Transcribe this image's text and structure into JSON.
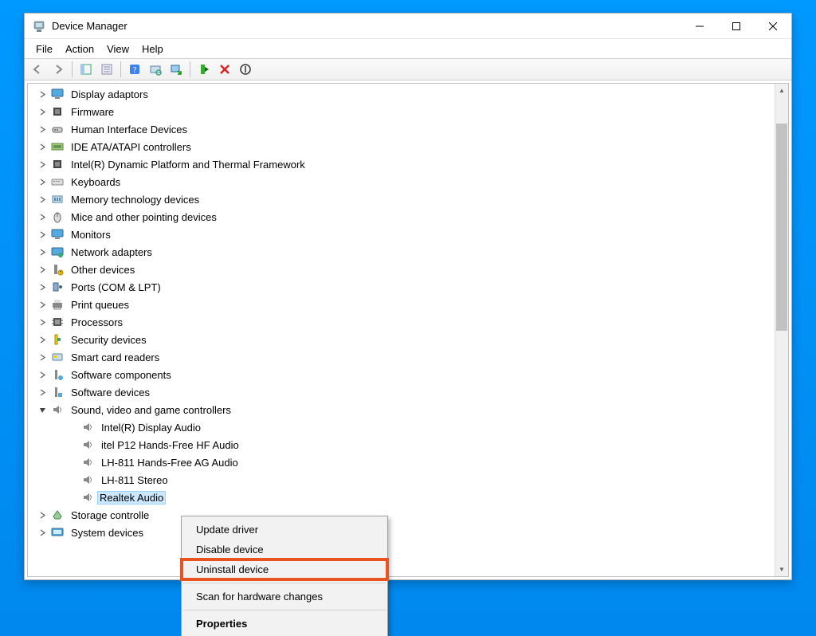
{
  "window": {
    "title": "Device Manager"
  },
  "menu": {
    "file": "File",
    "action": "Action",
    "view": "View",
    "help": "Help"
  },
  "tree": {
    "items": [
      {
        "label": "Display adaptors",
        "icon": "monitor"
      },
      {
        "label": "Firmware",
        "icon": "chip"
      },
      {
        "label": "Human Interface Devices",
        "icon": "hid"
      },
      {
        "label": "IDE ATA/ATAPI controllers",
        "icon": "ide"
      },
      {
        "label": "Intel(R) Dynamic Platform and Thermal Framework",
        "icon": "chip"
      },
      {
        "label": "Keyboards",
        "icon": "keyboard"
      },
      {
        "label": "Memory technology devices",
        "icon": "memory"
      },
      {
        "label": "Mice and other pointing devices",
        "icon": "mouse"
      },
      {
        "label": "Monitors",
        "icon": "monitor"
      },
      {
        "label": "Network adapters",
        "icon": "network"
      },
      {
        "label": "Other devices",
        "icon": "other"
      },
      {
        "label": "Ports (COM & LPT)",
        "icon": "port"
      },
      {
        "label": "Print queues",
        "icon": "printer"
      },
      {
        "label": "Processors",
        "icon": "cpu"
      },
      {
        "label": "Security devices",
        "icon": "security"
      },
      {
        "label": "Smart card readers",
        "icon": "smartcard"
      },
      {
        "label": "Software components",
        "icon": "softcomp"
      },
      {
        "label": "Software devices",
        "icon": "softdev"
      },
      {
        "label": "Sound, video and game controllers",
        "icon": "speaker",
        "expanded": true
      },
      {
        "label": "Storage controllers",
        "icon": "storage",
        "truncated": true,
        "display": "Storage controlle"
      },
      {
        "label": "System devices",
        "icon": "system",
        "truncated": true,
        "display": "System devices"
      }
    ],
    "sound_children": [
      {
        "label": "Intel(R) Display Audio"
      },
      {
        "label": "itel P12 Hands-Free HF Audio"
      },
      {
        "label": "LH-811 Hands-Free AG Audio"
      },
      {
        "label": "LH-811 Stereo"
      },
      {
        "label": "Realtek Audio"
      }
    ]
  },
  "context_menu": {
    "items": [
      {
        "label": "Update driver",
        "highlighted": false
      },
      {
        "label": "Disable device",
        "highlighted": false
      },
      {
        "label": "Uninstall device",
        "highlighted": true
      },
      {
        "sep": true
      },
      {
        "label": "Scan for hardware changes",
        "highlighted": false
      },
      {
        "sep": true
      },
      {
        "label": "Properties",
        "bold": true,
        "highlighted": false
      }
    ]
  }
}
